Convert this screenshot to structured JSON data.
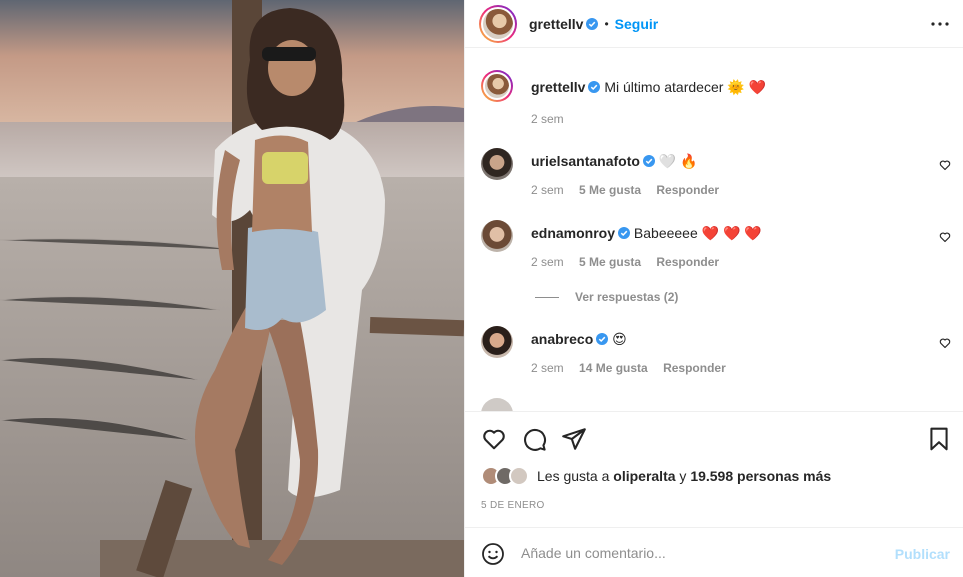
{
  "colors": {
    "link_blue": "#0095f6",
    "publish_disabled": "#b2dffc",
    "muted": "#8e8e8e",
    "text": "#262626",
    "heart_red": "#ed4956"
  },
  "header": {
    "username": "grettellv",
    "separator": "•",
    "follow_label": "Seguir"
  },
  "caption": {
    "username": "grettellv",
    "text": "Mi último atardecer",
    "emojis": "🌞 ❤️",
    "time": "2 sem"
  },
  "comments": [
    {
      "username": "urielsantanafoto",
      "text": "🤍 🔥",
      "time": "2 sem",
      "likes": "5 Me gusta",
      "reply": "Responder"
    },
    {
      "username": "ednamonroy",
      "text": "Babeeeee ❤️ ❤️ ❤️",
      "time": "2 sem",
      "likes": "5 Me gusta",
      "reply": "Responder",
      "view_replies": "Ver respuestas (2)"
    },
    {
      "username": "anabreco",
      "text": "😍",
      "time": "2 sem",
      "likes": "14 Me gusta",
      "reply": "Responder"
    }
  ],
  "likes": {
    "prefix": "Les gusta a",
    "user": "oliperalta",
    "connector": "y",
    "others": "19.598 personas más"
  },
  "date": "5 DE ENERO",
  "add_comment": {
    "placeholder": "Añade un comentario...",
    "publish_label": "Publicar"
  },
  "icons": {
    "more": "more-horizontal-icon",
    "like": "heart-outline-icon",
    "comment": "comment-bubble-icon",
    "share": "paper-plane-icon",
    "save": "bookmark-icon",
    "emoji": "smiley-icon",
    "verified": "verified-badge-icon"
  }
}
